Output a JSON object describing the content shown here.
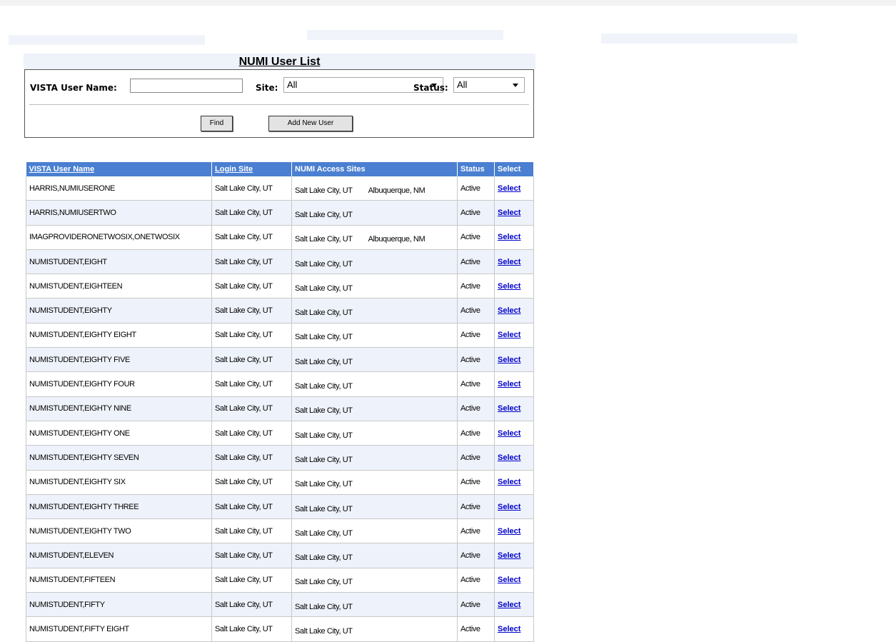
{
  "page": {
    "title": "NUMI User List"
  },
  "search": {
    "user_label": "VISTA User Name:",
    "user_value": "",
    "site_label": "Site:",
    "site_value": "All",
    "status_label": "Status:",
    "status_value": "All",
    "find_label": "Find",
    "add_label": "Add New User"
  },
  "table": {
    "headers": [
      "VISTA User Name",
      "Login Site",
      "NUMI Access Sites",
      "Status",
      "Select"
    ],
    "rows": [
      {
        "name": "HARRIS,NUMIUSERONE",
        "login": "Salt Lake City, UT",
        "site1": "Salt Lake City, UT",
        "site2": "Albuquerque, NM",
        "status": "Active",
        "select": "Select"
      },
      {
        "name": "HARRIS,NUMIUSERTWO",
        "login": "Salt Lake City, UT",
        "site1": "Salt Lake City, UT",
        "site2": "",
        "status": "Active",
        "select": "Select"
      },
      {
        "name": "IMAGPROVIDERONETWOSIX,ONETWOSIX",
        "login": "Salt Lake City, UT",
        "site1": "Salt Lake City, UT",
        "site2": "Albuquerque, NM",
        "status": "Active",
        "select": "Select"
      },
      {
        "name": "NUMISTUDENT,EIGHT",
        "login": "Salt Lake City, UT",
        "site1": "Salt Lake City, UT",
        "site2": "",
        "status": "Active",
        "select": "Select"
      },
      {
        "name": "NUMISTUDENT,EIGHTEEN",
        "login": "Salt Lake City, UT",
        "site1": "Salt Lake City, UT",
        "site2": "",
        "status": "Active",
        "select": "Select"
      },
      {
        "name": "NUMISTUDENT,EIGHTY",
        "login": "Salt Lake City, UT",
        "site1": "Salt Lake City, UT",
        "site2": "",
        "status": "Active",
        "select": "Select"
      },
      {
        "name": "NUMISTUDENT,EIGHTY EIGHT",
        "login": "Salt Lake City, UT",
        "site1": "Salt Lake City, UT",
        "site2": "",
        "status": "Active",
        "select": "Select"
      },
      {
        "name": "NUMISTUDENT,EIGHTY FIVE",
        "login": "Salt Lake City, UT",
        "site1": "Salt Lake City, UT",
        "site2": "",
        "status": "Active",
        "select": "Select"
      },
      {
        "name": "NUMISTUDENT,EIGHTY FOUR",
        "login": "Salt Lake City, UT",
        "site1": "Salt Lake City, UT",
        "site2": "",
        "status": "Active",
        "select": "Select"
      },
      {
        "name": "NUMISTUDENT,EIGHTY NINE",
        "login": "Salt Lake City, UT",
        "site1": "Salt Lake City, UT",
        "site2": "",
        "status": "Active",
        "select": "Select"
      },
      {
        "name": "NUMISTUDENT,EIGHTY ONE",
        "login": "Salt Lake City, UT",
        "site1": "Salt Lake City, UT",
        "site2": "",
        "status": "Active",
        "select": "Select"
      },
      {
        "name": "NUMISTUDENT,EIGHTY SEVEN",
        "login": "Salt Lake City, UT",
        "site1": "Salt Lake City, UT",
        "site2": "",
        "status": "Active",
        "select": "Select"
      },
      {
        "name": "NUMISTUDENT,EIGHTY SIX",
        "login": "Salt Lake City, UT",
        "site1": "Salt Lake City, UT",
        "site2": "",
        "status": "Active",
        "select": "Select"
      },
      {
        "name": "NUMISTUDENT,EIGHTY THREE",
        "login": "Salt Lake City, UT",
        "site1": "Salt Lake City, UT",
        "site2": "",
        "status": "Active",
        "select": "Select"
      },
      {
        "name": "NUMISTUDENT,EIGHTY TWO",
        "login": "Salt Lake City, UT",
        "site1": "Salt Lake City, UT",
        "site2": "",
        "status": "Active",
        "select": "Select"
      },
      {
        "name": "NUMISTUDENT,ELEVEN",
        "login": "Salt Lake City, UT",
        "site1": "Salt Lake City, UT",
        "site2": "",
        "status": "Active",
        "select": "Select"
      },
      {
        "name": "NUMISTUDENT,FIFTEEN",
        "login": "Salt Lake City, UT",
        "site1": "Salt Lake City, UT",
        "site2": "",
        "status": "Active",
        "select": "Select"
      },
      {
        "name": "NUMISTUDENT,FIFTY",
        "login": "Salt Lake City, UT",
        "site1": "Salt Lake City, UT",
        "site2": "",
        "status": "Active",
        "select": "Select"
      },
      {
        "name": "NUMISTUDENT,FIFTY EIGHT",
        "login": "Salt Lake City, UT",
        "site1": "Salt Lake City, UT",
        "site2": "",
        "status": "Active",
        "select": "Select"
      }
    ]
  }
}
